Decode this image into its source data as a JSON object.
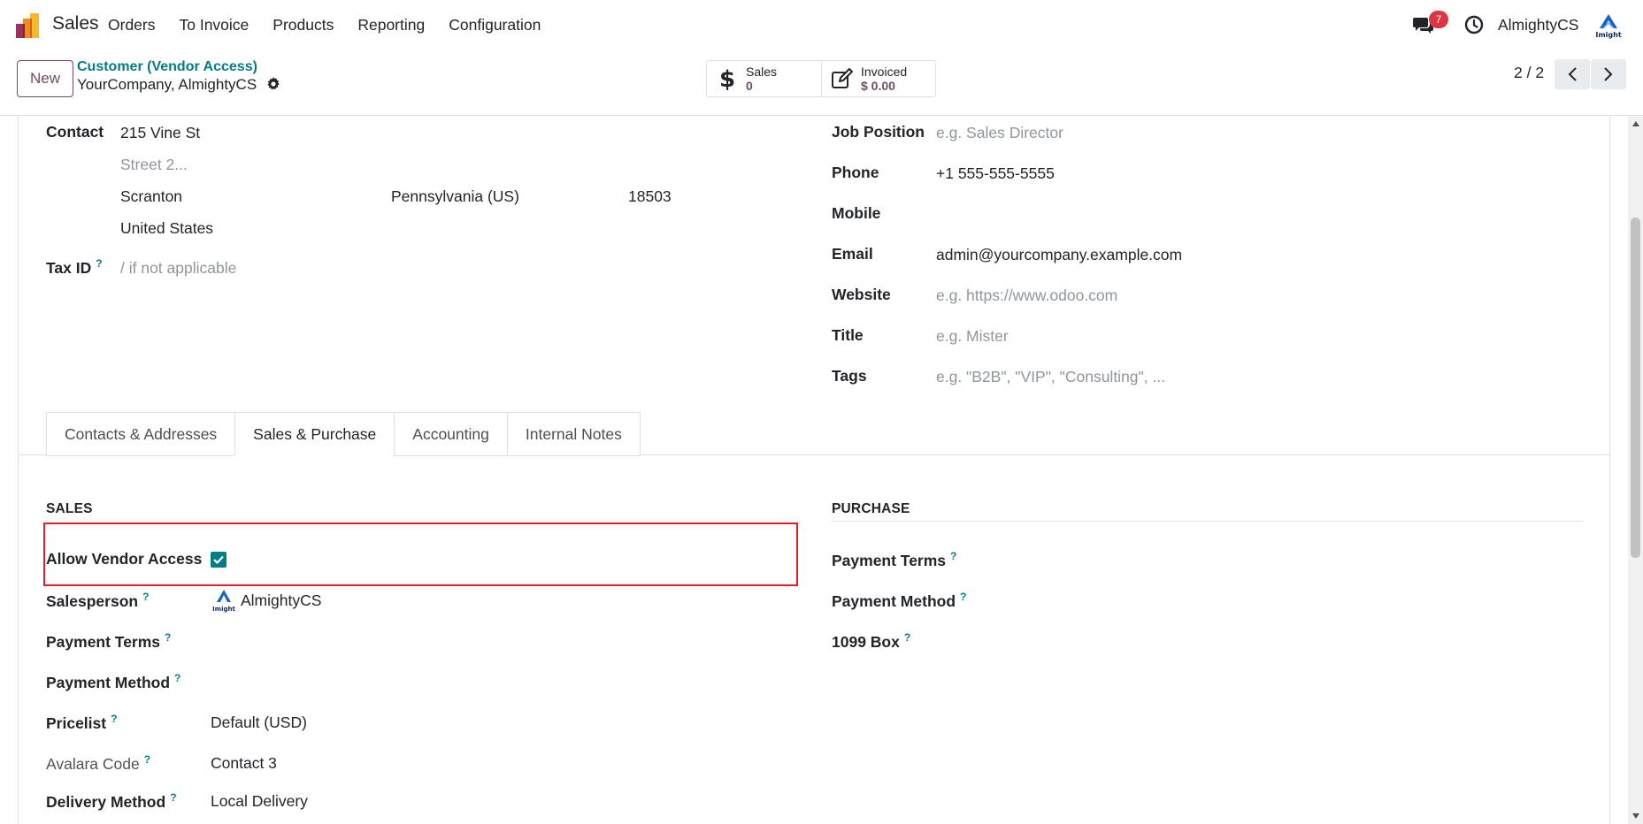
{
  "app": {
    "name": "Sales"
  },
  "navbar": {
    "menu": [
      "Orders",
      "To Invoice",
      "Products",
      "Reporting",
      "Configuration"
    ],
    "chat_badge": "7",
    "user_name": "AlmightyCS",
    "logo_text": "Imight"
  },
  "control_panel": {
    "new_label": "New",
    "breadcrumb_parent": "Customer (Vendor Access)",
    "breadcrumb_current": "YourCompany, AlmightyCS",
    "smart_buttons": [
      {
        "label": "Sales",
        "value": "0",
        "icon": "dollar-icon"
      },
      {
        "label": "Invoiced",
        "value": "$ 0.00",
        "icon": "pencil-square-icon"
      }
    ],
    "pager": "2 / 2"
  },
  "form": {
    "contact_label": "Contact",
    "street": "215 Vine St",
    "street2_placeholder": "Street 2...",
    "city": "Scranton",
    "state": "Pennsylvania (US)",
    "zip": "18503",
    "country": "United States",
    "tax_id_label": "Tax ID",
    "tax_id_placeholder": "/ if not applicable",
    "job_position_label": "Job Position",
    "job_position_placeholder": "e.g. Sales Director",
    "phone_label": "Phone",
    "phone": "+1 555-555-5555",
    "mobile_label": "Mobile",
    "email_label": "Email",
    "email": "admin@yourcompany.example.com",
    "website_label": "Website",
    "website_placeholder": "e.g. https://www.odoo.com",
    "title_label": "Title",
    "title_placeholder": "e.g. Mister",
    "tags_label": "Tags",
    "tags_placeholder": "e.g. \"B2B\", \"VIP\", \"Consulting\", ..."
  },
  "tabs": [
    "Contacts & Addresses",
    "Sales & Purchase",
    "Accounting",
    "Internal Notes"
  ],
  "active_tab": "Sales & Purchase",
  "sales": {
    "title": "SALES",
    "allow_vendor_access_label": "Allow Vendor Access",
    "allow_vendor_access": true,
    "salesperson_label": "Salesperson",
    "salesperson": "AlmightyCS",
    "payment_terms_label": "Payment Terms",
    "payment_method_label": "Payment Method",
    "pricelist_label": "Pricelist",
    "pricelist": "Default (USD)",
    "avalara_label": "Avalara Code",
    "avalara": "Contact 3",
    "delivery_label": "Delivery Method",
    "delivery": "Local Delivery"
  },
  "purchase": {
    "title": "PURCHASE",
    "payment_terms_label": "Payment Terms",
    "payment_method_label": "Payment Method",
    "box_1099_label": "1099 Box"
  },
  "help_mark": "?",
  "colors": {
    "brand": "#714b67",
    "accent": "#017e84",
    "highlight": "#e11d2c",
    "badge": "#dc3545"
  }
}
